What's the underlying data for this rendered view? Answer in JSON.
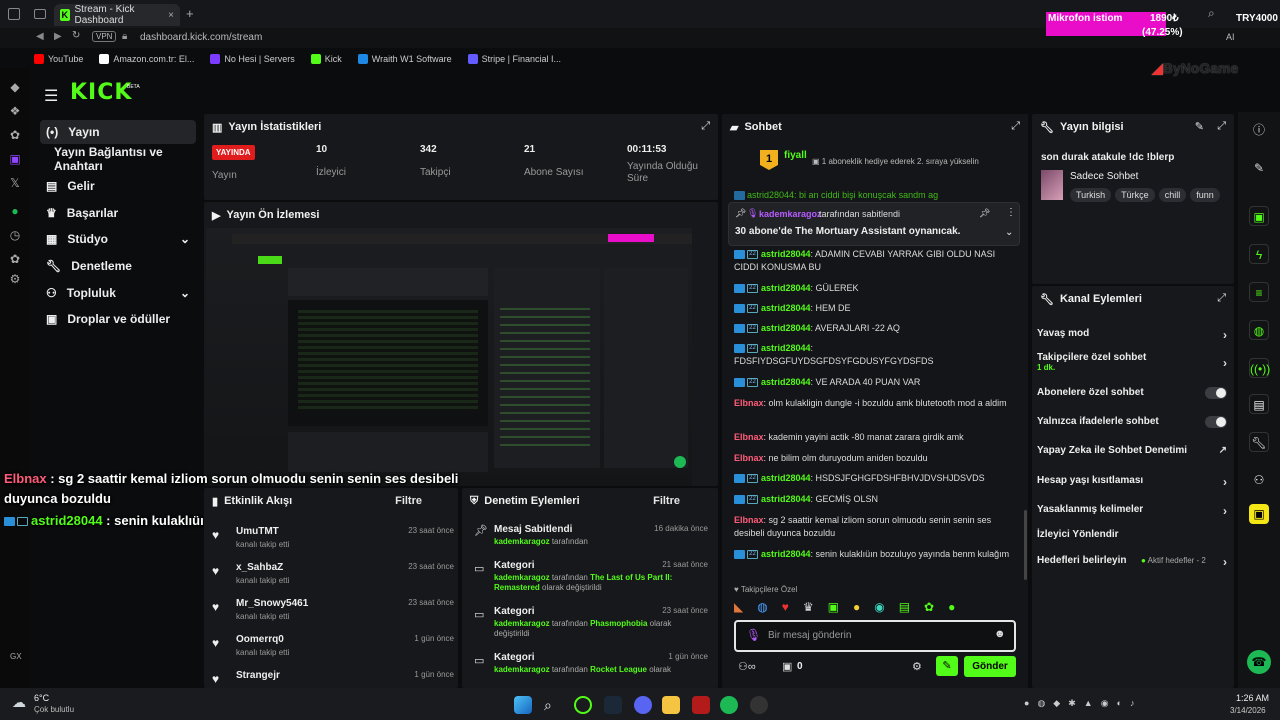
{
  "browser": {
    "tab_title": "Stream - Kick Dashboard",
    "url": "dashboard.kick.com/stream",
    "vpn": "VPN",
    "bookmarks": [
      "YouTube",
      "Amazon.com.tr: El...",
      "No Hesi | Servers",
      "Kick",
      "Wraith W1 Software",
      "Stripe | Financial I..."
    ]
  },
  "overlay": {
    "mic_label": "Mikrofon istiom",
    "mic_amount": "1890₺",
    "mic_pct": "(47.25%)",
    "mic_goal": "TRY4000",
    "brand": "ByNoGame",
    "chat_overlay": [
      {
        "user": "Elbnax",
        "text": " : sg 2 saattir kemal izliom sorun olmuodu senin senin ses desibeli duyunca bozuldu"
      },
      {
        "user": "astrid28044",
        "text": " : senin kulaklıüın bozuluyo yayında benm kulağım"
      }
    ]
  },
  "sidebar": {
    "logo": "KICK",
    "logo_beta": "BETA",
    "items": [
      {
        "label": "Yayın",
        "icon": "broadcast-icon"
      },
      {
        "label": "Yayın Bağlantısı ve Anahtarı",
        "icon": ""
      },
      {
        "label": "Gelir",
        "icon": "chart-icon"
      },
      {
        "label": "Başarılar",
        "icon": "trophy-icon"
      },
      {
        "label": "Stüdyo",
        "icon": "studio-icon"
      },
      {
        "label": "Denetleme",
        "icon": "wrench-icon"
      },
      {
        "label": "Topluluk",
        "icon": "community-icon"
      },
      {
        "label": "Droplar ve ödüller",
        "icon": "gift-icon"
      }
    ]
  },
  "stats": {
    "title": "Yayın İstatistikleri",
    "live_badge": "YAYINDA",
    "items": [
      {
        "value": "",
        "label": "Yayın"
      },
      {
        "value": "10",
        "label": "İzleyici"
      },
      {
        "value": "342",
        "label": "Takipçi"
      },
      {
        "value": "21",
        "label": "Abone Sayısı"
      },
      {
        "value": "00:11:53",
        "label": "Yayında Olduğu Süre"
      }
    ]
  },
  "preview": {
    "title": "Yayın Ön İzlemesi"
  },
  "events": {
    "title": "Etkinlik Akışı",
    "filter": "Filtre",
    "rows": [
      {
        "name": "UmuTMT",
        "sub": "kanalı takip etti",
        "time": "23 saat önce"
      },
      {
        "name": "x_SahbaZ",
        "sub": "kanalı takip etti",
        "time": "23 saat önce"
      },
      {
        "name": "Mr_Snowy5461",
        "sub": "kanalı takip etti",
        "time": "23 saat önce"
      },
      {
        "name": "Oomerrq0",
        "sub": "kanalı takip etti",
        "time": "1 gün önce"
      },
      {
        "name": "Strangejr",
        "sub": "",
        "time": "1 gün önce"
      }
    ]
  },
  "mod": {
    "title": "Denetim Eylemleri",
    "filter": "Filtre",
    "rows": [
      {
        "title": "Mesaj Sabitlendi",
        "time": "16 dakika önce",
        "user": "kademkaragoz",
        "mid": " tarafından",
        "target": "",
        "tail": ""
      },
      {
        "title": "Kategori",
        "time": "21 saat önce",
        "user": "kademkaragoz",
        "mid": " tarafından ",
        "target": "The Last of Us Part II: Remastered",
        "tail": " olarak değiştirildi"
      },
      {
        "title": "Kategori",
        "time": "23 saat önce",
        "user": "kademkaragoz",
        "mid": " tarafından ",
        "target": "Phasmophobia",
        "tail": " olarak değiştirildi"
      },
      {
        "title": "Kategori",
        "time": "1 gün önce",
        "user": "kademkaragoz",
        "mid": " tarafından ",
        "target": "Rocket League",
        "tail": " olarak"
      }
    ]
  },
  "chat": {
    "title": "Sohbet",
    "gift_user": "fiyall",
    "gift_count": "1",
    "gift_text": "1 aboneklik hediye ederek 2. sıraya yükselin",
    "pinned_by": "kademkaragoz",
    "pinned_by_suffix": "tarafından sabitlendi",
    "pinned_text": "30 abone'de The Mortuary Assistant oynanıcak.",
    "partial_line": "astrid28044: bi an ciddi bişi konuşcak sandm ag",
    "messages": [
      {
        "user": "astrid28044",
        "type": "g",
        "text": ": ADAMIN CEVABI YARRAK GIBI OLDU NASI CIDDI KONUSMA BU"
      },
      {
        "user": "astrid28044",
        "type": "g",
        "text": ": GÜLEREK"
      },
      {
        "user": "astrid28044",
        "type": "g",
        "text": ": HEM DE"
      },
      {
        "user": "astrid28044",
        "type": "g",
        "text": ": AVERAJLARI -22 AQ"
      },
      {
        "user": "astrid28044",
        "type": "g",
        "text": ": FDSFIYDSGFUYDSGFDSYFGDUSYFGYDSFDS"
      },
      {
        "user": "astrid28044",
        "type": "g",
        "text": ": VE ARADA 40 PUAN VAR"
      },
      {
        "user": "Elbnax",
        "type": "r",
        "text": ": olm kulakligin dungle -i bozuldu amk blutetooth mod a aldim"
      },
      {
        "user": "Elbnax",
        "type": "r",
        "text": ": kademin yayini actik -80 manat zarara girdik amk"
      },
      {
        "user": "Elbnax",
        "type": "r",
        "text": ": ne bilim olm duruyodum aniden bozuldu"
      },
      {
        "user": "astrid28044",
        "type": "g",
        "text": ": HSDSJFGHGFDSHFBHVJDVSHJDSVDS"
      },
      {
        "user": "astrid28044",
        "type": "g",
        "text": ": GECMİŞ OLSN"
      },
      {
        "user": "Elbnax",
        "type": "r",
        "text": ": sg 2 saattir kemal izliom sorun olmuodu senin senin ses desibeli duyunca bozuldu"
      },
      {
        "user": "astrid28044",
        "type": "g",
        "text": ": senin kulaklıüın bozuluyo yayında benm kulağım"
      }
    ],
    "followers_label": "Takipçilere Özel",
    "input_placeholder": "Bir mesaj gönderin",
    "points": "0",
    "send": "Gönder"
  },
  "info": {
    "title": "Yayın bilgisi",
    "stream_title": "son durak atakule !dc !blerp",
    "category": "Sadece Sohbet",
    "tags": [
      "Turkish",
      "Türkçe",
      "chill",
      "funn"
    ]
  },
  "actions": {
    "title": "Kanal Eylemleri",
    "rows": [
      {
        "label": "Yavaş mod",
        "ctrl": "chev",
        "sub": ""
      },
      {
        "label": "Takipçilere özel sohbet",
        "ctrl": "chev",
        "sub": "1 dk."
      },
      {
        "label": "Abonelere özel sohbet",
        "ctrl": "toggle",
        "sub": ""
      },
      {
        "label": "Yalnızca ifadelerle sohbet",
        "ctrl": "toggle",
        "sub": ""
      },
      {
        "label": "Yapay Zeka ile Sohbet Denetimi",
        "ctrl": "ext",
        "sub": ""
      },
      {
        "label": "Hesap yaşı kısıtlaması",
        "ctrl": "chev",
        "sub": ""
      },
      {
        "label": "Yasaklanmış kelimeler",
        "ctrl": "chev",
        "sub": ""
      },
      {
        "label": "İzleyici Yönlendir",
        "ctrl": "",
        "sub": ""
      },
      {
        "label": "Hedefleri belirleyin",
        "ctrl": "chev",
        "sub": "Aktif hedefler - 2"
      }
    ]
  },
  "taskbar": {
    "weather_temp": "6°C",
    "weather_desc": "Çok bulutlu",
    "time": "1:26 AM",
    "date": "3/14/2026",
    "gx": "GX"
  },
  "colors": {
    "accent": "#53fc18",
    "live": "#e01c1c",
    "mic": "#e90cc8"
  }
}
